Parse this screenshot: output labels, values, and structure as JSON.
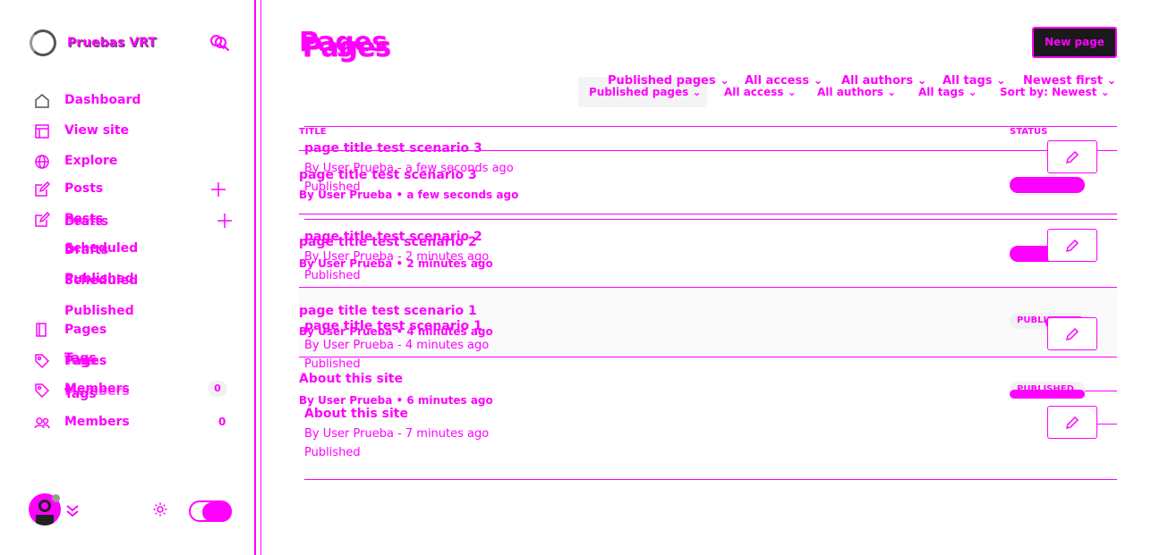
{
  "site": {
    "title": "Pruebas VRT"
  },
  "nav": {
    "dashboard": "Dashboard",
    "view_site": "View site",
    "explore": "Explore",
    "posts": "Posts",
    "drafts": "Drafts",
    "scheduled": "Scheduled",
    "published": "Published",
    "pages": "Pages",
    "tags": "Tags",
    "members": "Members",
    "members_count": "0"
  },
  "nav_overlay": {
    "posts": "Posts",
    "drafts": "Drafts",
    "scheduled": "Scheduled",
    "published": "Published",
    "pages": "Pages",
    "tags": "Tags",
    "members": "Members",
    "members_count": "0"
  },
  "header": {
    "title": "Pages",
    "new_button": "New page"
  },
  "filters": {
    "type": "Published pages",
    "access": "All access",
    "authors": "All authors",
    "tags": "All tags",
    "sort": "Newest first"
  },
  "filters_overlay": {
    "type": "Published pages",
    "access": "All access",
    "authors": "All authors",
    "tags": "All tags",
    "sort": "Sort by: Newest"
  },
  "table": {
    "col_title": "TITLE",
    "col_status": "STATUS"
  },
  "rows_a": [
    {
      "title": "page title test scenario 3",
      "meta": "By User Prueba - a few seconds ago",
      "status": "Published"
    },
    {
      "title": "page title test scenario 2",
      "meta": "By User Prueba - 2 minutes ago",
      "status": "Published"
    },
    {
      "title": "page title test scenario 1",
      "meta": "By User Prueba - 4 minutes ago",
      "status": "Published"
    },
    {
      "title": "About this site",
      "meta": "By User Prueba - 7 minutes ago",
      "status": "Published"
    }
  ],
  "rows_b": [
    {
      "title": "page title test scenario 3",
      "by": "By",
      "author": "User Prueba",
      "time": "a few seconds ago"
    },
    {
      "title": "page title test scenario 2",
      "by": "By",
      "author": "User Prueba",
      "time": "2 minutes ago"
    },
    {
      "title": "page title test scenario 1",
      "by": "By",
      "author": "User Prueba",
      "time": "4 minutes ago",
      "badge": "PUBLISHED"
    },
    {
      "title": "About this site",
      "by": "By",
      "author": "User Prueba",
      "time": "6 minutes ago",
      "badge": "PUBLISHED"
    }
  ],
  "icons": {
    "search": "search-icon",
    "home": "home-icon",
    "window": "browser-icon",
    "globe": "globe-icon",
    "edit": "edit-icon",
    "plus": "plus-icon",
    "book": "book-icon",
    "tag": "tag-icon",
    "users": "users-icon",
    "gear": "gear-icon",
    "pencil": "pencil-icon",
    "chevron": "chevron-down-icon"
  },
  "colors": {
    "accent": "#ff00ff",
    "button_bg": "#1a1a1a"
  }
}
